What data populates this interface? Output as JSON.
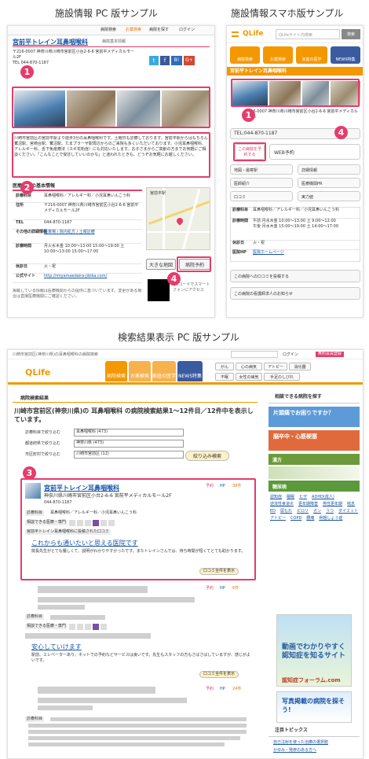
{
  "captions": {
    "pc": "施設情報 PC 版サンプル",
    "sp": "施設情報スマホ版サンプル",
    "search": "検索結果表示 PC 版サンプル"
  },
  "markers": [
    "1",
    "2",
    "3",
    "4"
  ],
  "pc": {
    "top_links": [
      "病院検索",
      "お薬検索",
      "病院を探す",
      "ログイン"
    ],
    "clinic_name": "宮前平トレイン耳鼻咽喉科",
    "sub_title": "病院基本情報",
    "address_block": "〒216-0007 神奈川県川崎市宮前区小台2-6-6 宮前平メディカルモール2F\nTEL 044-870-1187",
    "social": [
      "t",
      "f",
      "B!",
      "G+"
    ],
    "desc": "川崎市宮前区の宮前平駅より徒歩3分の耳鼻咽喉科です。土曜日も診療しております。宮前平駅からはもちろん鷺沼駅、宮崎台駅、鷺沼駅、たまプラーザ駅周辺からのご来院も多くいただいております。小児耳鼻咽喉科、アレルギー科、舌下免疫療法（スギ花粉症）にも対応いたします。お子さまからご高齢の方までお気軽にご相談ください。「こんなことで受診していいのかな」と迷われたときも、どうぞお気軽にお越しください。",
    "info_title": "医療機関の基本情報",
    "info_rows": [
      {
        "k": "診療科目",
        "v": "耳鼻咽喉科／アレルギー科／小児耳鼻いんこう科"
      },
      {
        "k": "住所",
        "v": "〒216-0007 神奈川県川崎市宮前区小台2-6-6 宮前平メディカルモール2F"
      },
      {
        "k": "TEL",
        "v": "044-870-1187"
      },
      {
        "k": "その他の詳細情報",
        "v": "駐車場 / 院内処方 / 土曜診療"
      },
      {
        "k": "診療時間",
        "v": "月火水木金 10:00〜13:00 15:00〜19:00 土 10:00〜13:00 15:00〜17:00"
      },
      {
        "k": "休診日",
        "v": "火・祝"
      },
      {
        "k": "公式サイト",
        "v": "http://miyamaedaira-jibika.com/"
      }
    ],
    "footer_note": "掲載している情報は医療機関からの提供に基づいています。変更がある場合は直接医療機関にご確認ください。",
    "map_label": "宮前平駅",
    "map_buttons": [
      "大きな地図",
      "病院予約"
    ],
    "qr_note": "QRコードでスマートフォンにアクセス"
  },
  "sp": {
    "logo": "QLife",
    "search_placeholder": "QLifeサイト内検索",
    "search_btn": "検索",
    "tabs": [
      "病院検索",
      "お薬検索",
      "家庭の医学",
      "NEWS特集"
    ],
    "clinic_name": "宮前平トレイン耳鼻咽喉科",
    "address": "〒216-0007 神奈川県川崎市宮前区小台2-6-6 宮前平メディカルモール",
    "tel": "TEL:044-870-1187",
    "reserve_btn": "この病院を予約する",
    "web_reserve": "WEB予約",
    "menu": [
      "地図・最寄駅",
      "詳細情報",
      "医師紹介",
      "医療機関PR",
      "口コミ",
      "実力値"
    ],
    "table": [
      {
        "k": "診療科目",
        "v": "耳鼻咽喉科／アレルギー科／小児耳鼻いんこう科"
      },
      {
        "k": "診療時間",
        "v": "午前 月水木金 10:00〜13:00 土 9:00〜12:00\n午後 月水木金 15:00〜19:00 土 14:00〜17:00"
      },
      {
        "k": "休診日",
        "v": "火・祝"
      },
      {
        "k": "医院HP",
        "v": "医院ホームページ"
      }
    ],
    "bottom_links": [
      "この病院への口コミを投稿する",
      "この病院の看護師求人のお知らせ"
    ]
  },
  "search": {
    "breadcrumb": "川崎市宮前区(神奈川県)の耳鼻咽喉科の病院検索",
    "login": "ログイン",
    "register": "無料会員登録",
    "logo": "QLife",
    "nav": [
      "病院検索",
      "お薬検索",
      "家庭の医学",
      "NEWS特集"
    ],
    "tags": [
      "がん",
      "心の病気",
      "アトピー",
      "消化器",
      "不眠",
      "女性の病気",
      "手足のしびれ"
    ],
    "results_heading": "病院検索結果",
    "results_title": "川崎市宮前区(神奈川県)の 耳鼻咽喉科 の病院検索結果1〜12件目／12件中を表示しています。",
    "filters": [
      {
        "label": "診療科目で絞り込む",
        "value": "耳鼻咽喉科 (473)"
      },
      {
        "label": "都道府県で絞り込む",
        "value": "神奈川県 (473)"
      },
      {
        "label": "市区町村で絞り込む",
        "value": "川崎市宮前区 (12)"
      }
    ],
    "refine_btn": "絞り込み検索",
    "result1": {
      "name": "宮前平トレイン耳鼻咽喉科",
      "address": "神奈川県川崎市宮前区小台2-6-6 宮前平メディカルモール2F",
      "tel": "044-870-1187",
      "badges": [
        "予約",
        "HP",
        "38件"
      ],
      "dept_label": "診療科目",
      "dept": "耳鼻咽喉科／アレルギー科／小児耳鼻いんこう科",
      "spec_label": "相談できる医療・専門",
      "open_label": "宮前平トレイン耳鼻咽喉科に投稿された口コミ",
      "review_title": "これからも通いたいと思える医院です",
      "review": "院長先生がとても優しくて、説明がわかりやすかったです。またトレインさんでは、待ち時間が短くてとても助かります。",
      "more": "口コミ全件を表示"
    },
    "result2": {
      "review_title": "安心していけます",
      "review": "駅前、エレベーターあり。ネットでの予約などサービスは良いです。先生もスタッフの方もさばさばしていますが、感じがよいです。",
      "badges": [
        "予約",
        "HP",
        "6件"
      ],
      "more": "口コミ全件を表示"
    },
    "result3": {
      "badges": [
        "予約",
        "HP",
        "24件"
      ]
    },
    "side": {
      "consult": "相談できる病院を探す",
      "banner1": "片頭痛でお困りですか？",
      "banner2": "脳卒中・心筋梗塞",
      "kampo": "漢方",
      "diabetes": "糖尿病",
      "links": [
        "認知症",
        "睡眠",
        "ヒザ",
        "ADHD(成人)",
        "逆流性食道炎",
        "更年期障害",
        "男性更年期",
        "喘息",
        "ED",
        "尿もれ",
        "ピロリ",
        "ガン",
        "うつ",
        "ダイエット",
        "アトピー",
        "COPD",
        "腰痛",
        "骨粗しょう症"
      ],
      "ad1": "動画でわかりやすく 認知症を知るサイト",
      "ad1_brand": "認知症フォーラム.com",
      "ad2": "写真掲載の病院を探そう!",
      "topics": "注目トピックス",
      "topics_items": [
        "自己注射を使った治療の選択肢",
        "かゆみ・発疹のある方へ"
      ]
    }
  }
}
